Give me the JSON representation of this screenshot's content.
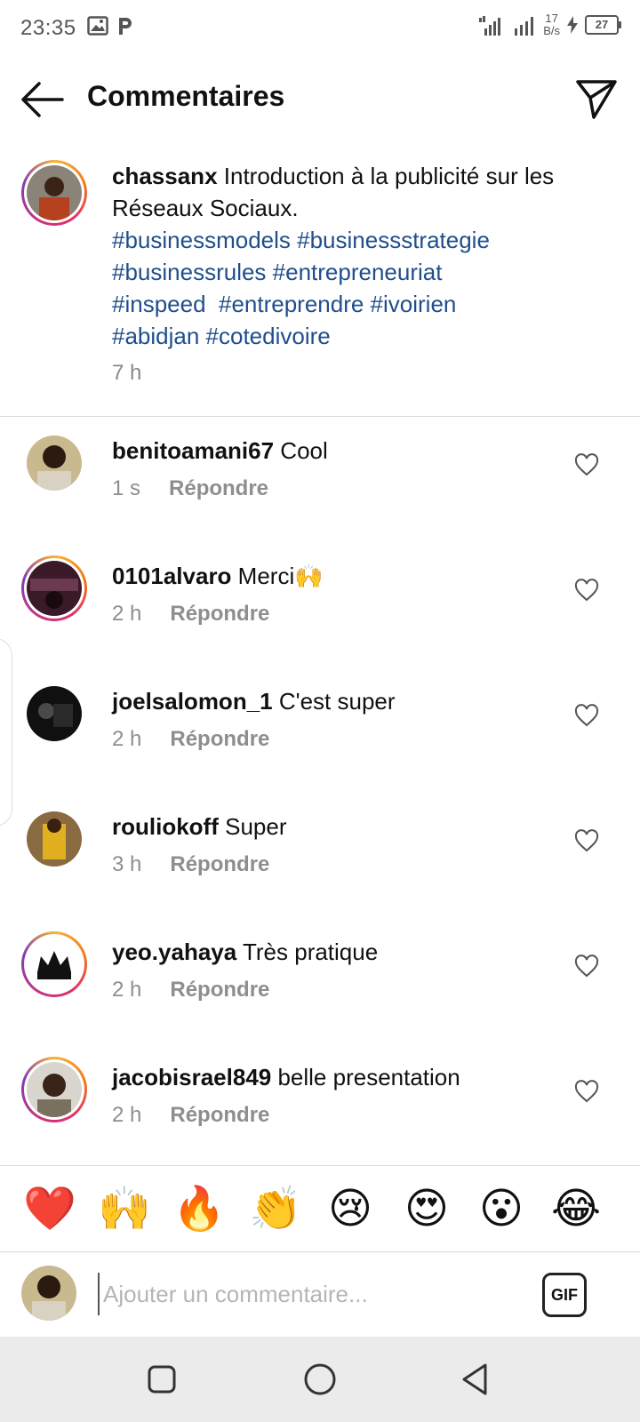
{
  "status_bar": {
    "time": "23:35",
    "netspeed_value": "17",
    "netspeed_unit": "B/s",
    "battery": "27"
  },
  "header": {
    "title": "Commentaires"
  },
  "caption": {
    "username": "chassanx",
    "text": " Introduction à la publicité sur les Réseaux Sociaux.",
    "hashtags_line1": "#businessmodels #businessstrategie",
    "hashtags_line2": "#businessrules #entrepreneuriat",
    "hashtags_line3": "#inspeed  #entreprendre #ivoirien",
    "hashtags_line4": "#abidjan #cotedivoire",
    "time": "7 h"
  },
  "comments": [
    {
      "username": "benitoamani67",
      "text": " Cool",
      "time": "1 s",
      "reply": "Répondre"
    },
    {
      "username": "0101alvaro",
      "text": " Merci🙌",
      "time": "2 h",
      "reply": "Répondre"
    },
    {
      "username": "joelsalomon_1",
      "text": " C'est super",
      "time": "2 h",
      "reply": "Répondre"
    },
    {
      "username": "rouliokoff",
      "text": " Super",
      "time": "3 h",
      "reply": "Répondre"
    },
    {
      "username": "yeo.yahaya",
      "text": " Très pratique",
      "time": "2 h",
      "reply": "Répondre"
    },
    {
      "username": "jacobisrael849",
      "text": " belle presentation",
      "time": "2 h",
      "reply": "Répondre"
    }
  ],
  "emoji_reactions": [
    "❤️",
    "🙌",
    "🔥",
    "👏",
    "😢",
    "😍",
    "😮",
    "😂"
  ],
  "comment_input": {
    "placeholder": "Ajouter un commentaire..."
  },
  "gif_button": "GIF",
  "colors": {
    "hashtag": "#1f4e8c",
    "secondary_text": "#8e8e8e",
    "story_ring": "#e1306c"
  }
}
